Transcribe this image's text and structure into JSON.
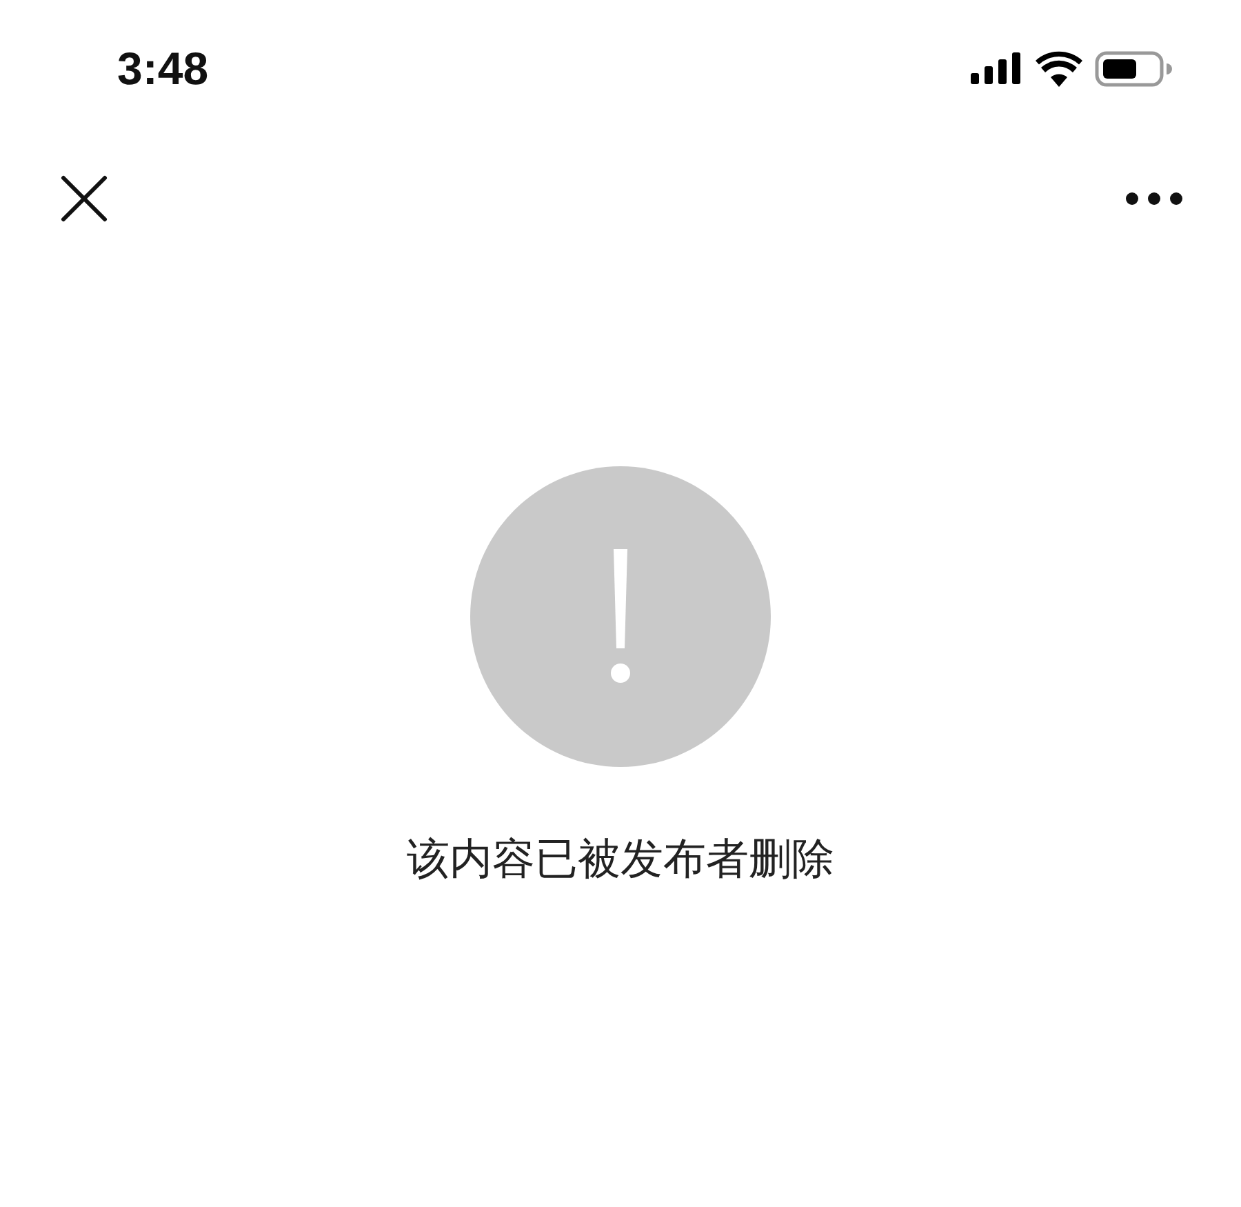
{
  "status_bar": {
    "time": "3:48"
  },
  "message": {
    "text": "该内容已被发布者删除"
  }
}
